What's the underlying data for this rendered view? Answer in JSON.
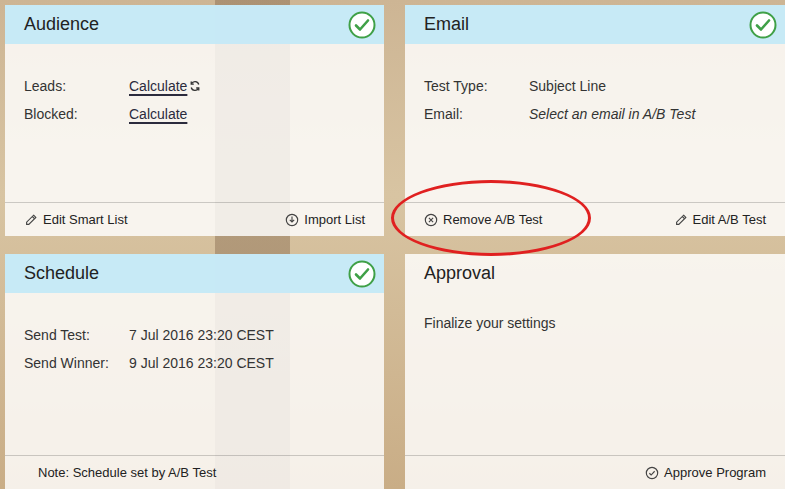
{
  "cards": [
    {
      "title": "Audience",
      "complete": true,
      "fields": [
        {
          "label": "Leads:",
          "value": "Calculate",
          "kind": "link",
          "refresh": true
        },
        {
          "label": "Blocked:",
          "value": "Calculate",
          "kind": "link",
          "refresh": false
        }
      ],
      "actions": [
        {
          "label": "Edit Smart List",
          "kind": "edit",
          "highlighted": false
        },
        {
          "label": "Import List",
          "kind": "import",
          "highlighted": false
        }
      ]
    },
    {
      "title": "Email",
      "complete": true,
      "fields": [
        {
          "label": "Test Type:",
          "value": "Subject Line",
          "kind": "text",
          "refresh": false
        },
        {
          "label": "Email:",
          "value": "Select an email in A/B Test",
          "kind": "hint",
          "refresh": false
        }
      ],
      "actions": [
        {
          "label": "Remove A/B Test",
          "kind": "remove",
          "highlighted": true
        },
        {
          "label": "Edit A/B Test",
          "kind": "edit",
          "highlighted": false
        }
      ]
    },
    {
      "title": "Schedule",
      "complete": true,
      "fields": [
        {
          "label": "Send Test:",
          "value": "7 Jul 2016 23:20 CEST",
          "kind": "text",
          "refresh": false
        },
        {
          "label": "Send Winner:",
          "value": "9 Jul 2016 23:20 CEST",
          "kind": "text",
          "refresh": false
        }
      ],
      "note": "Note: Schedule set by A/B Test",
      "actions": []
    },
    {
      "title": "Approval",
      "complete": false,
      "fields": [],
      "text": "Finalize your settings",
      "actions": [
        {
          "label": "Approve Program",
          "kind": "approve",
          "highlighted": false
        }
      ]
    }
  ]
}
